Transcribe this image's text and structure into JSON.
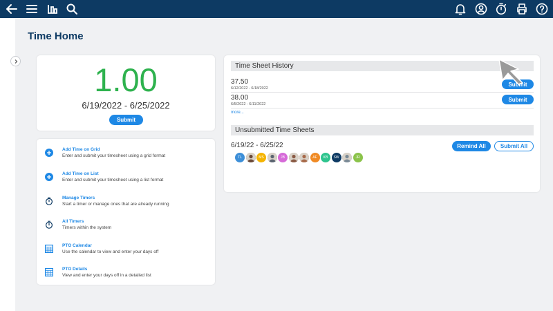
{
  "toolbar": {
    "left_icons": [
      "back-arrow-icon",
      "menu-icon",
      "reports-icon",
      "search-icon"
    ],
    "right_icons": [
      "bell-icon",
      "user-icon",
      "timer-icon",
      "print-icon",
      "help-icon"
    ]
  },
  "page": {
    "title": "Time Home"
  },
  "summary": {
    "hours": "1.00",
    "range": "6/19/2022 - 6/25/2022",
    "submit_label": "Submit",
    "hours_color": "#2eb24e"
  },
  "actions": [
    {
      "title": "Add Time on Grid",
      "description": "Enter and submit your timesheet using a grid format",
      "icon": "plus-circle-icon"
    },
    {
      "title": "Add Time on List",
      "description": "Enter and submit your timesheet using a list format",
      "icon": "plus-circle-icon"
    },
    {
      "title": "Manage Timers",
      "description": "Start a timer or manage ones that are already running",
      "icon": "stopwatch-icon"
    },
    {
      "title": "All Timers",
      "description": "Timers within the system",
      "icon": "stopwatch-icon"
    },
    {
      "title": "PTO Calendar",
      "description": "Use the calendar to view and enter your days off",
      "icon": "calendar-icon"
    },
    {
      "title": "PTO Details",
      "description": "View and enter your days off in a detailed list",
      "icon": "calendar-icon"
    }
  ],
  "history": {
    "title": "Time Sheet History",
    "rows": [
      {
        "hours": "37.50",
        "range": "6/12/2022 - 6/18/2022",
        "button": "Submit"
      },
      {
        "hours": "38.00",
        "range": "6/5/2022 - 6/11/2022",
        "button": "Submit"
      }
    ],
    "more_label": "more..."
  },
  "unsubmitted": {
    "title": "Unsubmitted Time Sheets",
    "range": "6/19/22 - 6/25/22",
    "remind_label": "Remind All",
    "submit_all_label": "Submit All",
    "avatars": [
      {
        "initials": "TL",
        "color": "#3d8fd8"
      },
      {
        "initials": "",
        "color": "#6b4a3a",
        "photo": true
      },
      {
        "initials": "MS",
        "color": "#f5b400"
      },
      {
        "initials": "",
        "color": "#5a6470",
        "photo": true
      },
      {
        "initials": "JB",
        "color": "#d66ad8"
      },
      {
        "initials": "",
        "color": "#8a5a44",
        "photo": true
      },
      {
        "initials": "",
        "color": "#a86a4a",
        "photo": true
      },
      {
        "initials": "AF",
        "color": "#f08a24"
      },
      {
        "initials": "KB",
        "color": "#2ec48e"
      },
      {
        "initials": "SW",
        "color": "#0d3a63"
      },
      {
        "initials": "",
        "color": "#7a8a96",
        "photo": true
      },
      {
        "initials": "JR",
        "color": "#8bc34a"
      }
    ]
  },
  "colors": {
    "topbar": "#0d3a63",
    "accent": "#1e88e5",
    "title": "#0d3a63"
  }
}
